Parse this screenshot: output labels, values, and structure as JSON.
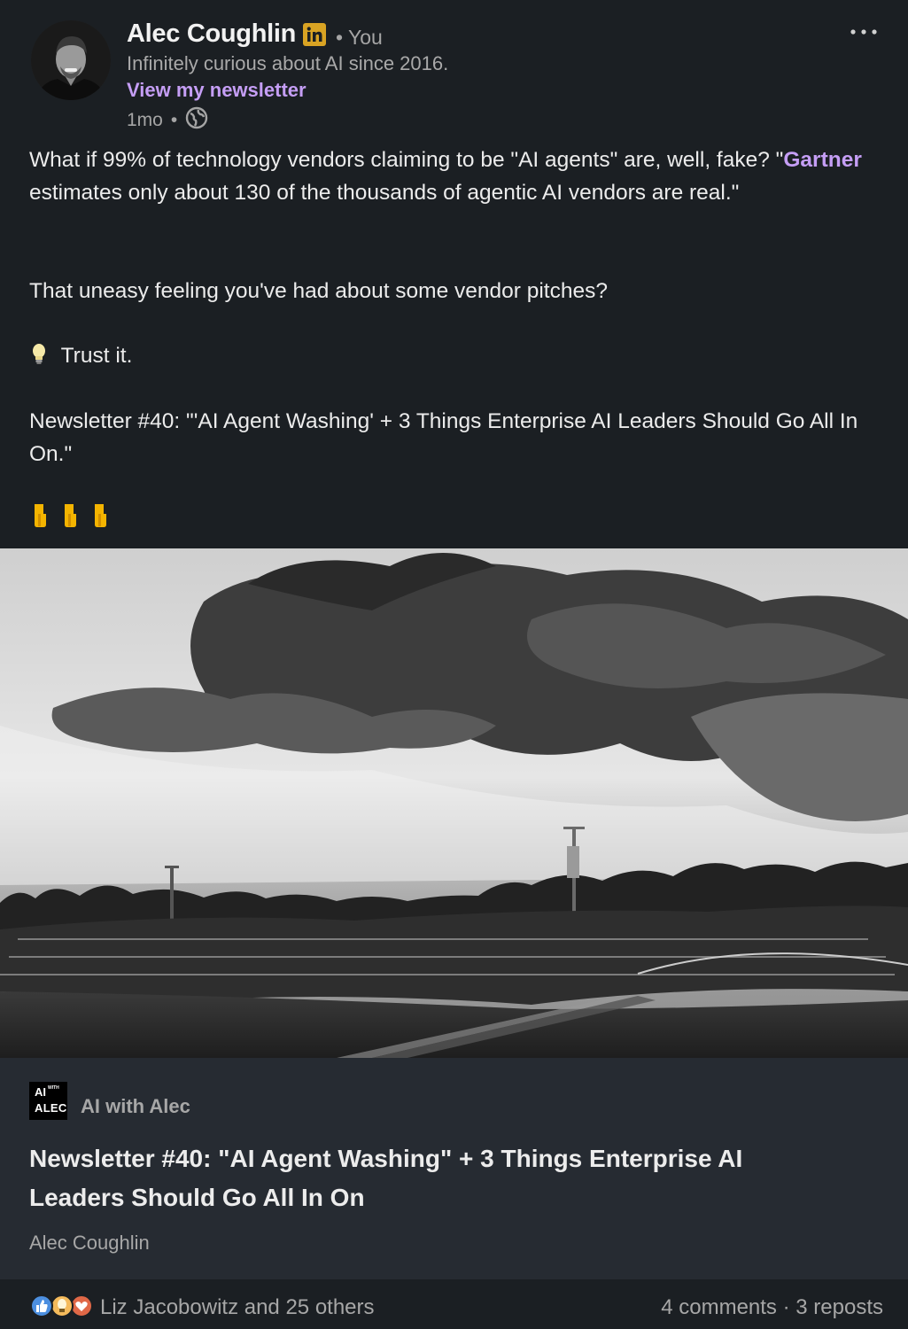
{
  "post": {
    "author_name": "Alec Coughlin",
    "author_badge_icon": "linkedin-in-icon",
    "relationship": "• You",
    "headline": "Infinitely curious about AI since 2016.",
    "newsletter_link": "View my newsletter",
    "time": "1mo",
    "meta_separator": "•",
    "visibility_icon": "globe-icon",
    "more_icon": "more-horizontal-icon"
  },
  "body": {
    "p1_before": "What if 99% of technology vendors claiming to be \"AI agents\" are, well, fake? \"",
    "mention": "Gartner",
    "p1_after": " estimates only about 130 of the thousands of agentic AI vendors are real.\"",
    "p2": "That uneasy feeling you've had about some vendor pitches?",
    "p3": "Trust it.",
    "p3_emoji": "💡",
    "p4": "Newsletter #40: \"'AI Agent Washing' + 3 Things Enterprise AI Leaders Should Go All In On.\"",
    "pointing_emojis": "👇 👇 👇"
  },
  "card": {
    "logo_line1": "AI",
    "logo_with": "WITH",
    "logo_line2": "ALEC",
    "publication": "AI with Alec",
    "title": "Newsletter #40: \"AI Agent Washing\" + 3 Things Enterprise AI Leaders Should Go All In On",
    "author": "Alec Coughlin"
  },
  "footer": {
    "reaction_icons": [
      "like-icon",
      "insightful-icon",
      "love-icon"
    ],
    "reactors": "Liz Jacobowitz and 25 others",
    "comments": "4 comments",
    "separator": "·",
    "reposts": "3 reposts"
  },
  "colors": {
    "background": "#1b1f23",
    "card_background": "#262b32",
    "link_purple": "#c59ef5",
    "linkedin_badge": "#d9a323"
  }
}
